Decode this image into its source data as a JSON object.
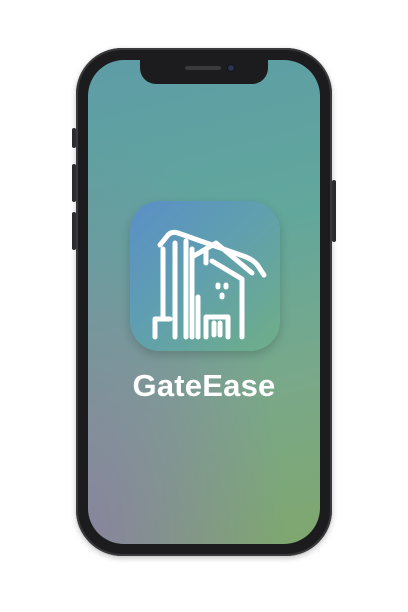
{
  "app": {
    "name": "GateEase",
    "icon": "gate-building-icon"
  },
  "colors": {
    "screen_top": "#5d9ca6",
    "screen_bottom_left": "#8c78aa",
    "screen_bottom_right": "#7fa76e",
    "icon_bg_start": "#5b8fc7",
    "icon_bg_end": "#6fae86",
    "phone_frame": "#1c1c1e",
    "label_text": "#ffffff"
  }
}
